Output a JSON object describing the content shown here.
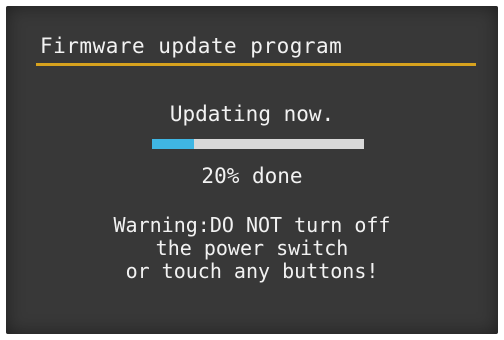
{
  "title": "Firmware update program",
  "status": "Updating now.",
  "progress": {
    "fraction": 0.2,
    "label": "20% done"
  },
  "warning": {
    "line1": "Warning:DO NOT turn off",
    "line2": "the power switch",
    "line3": "or touch any buttons!"
  },
  "colors": {
    "screen_bg": "#383838",
    "accent_rule": "#d7a21e",
    "progress_fill": "#3fb6e3",
    "progress_track": "#d8d8d8",
    "text": "#f2f2f2"
  }
}
